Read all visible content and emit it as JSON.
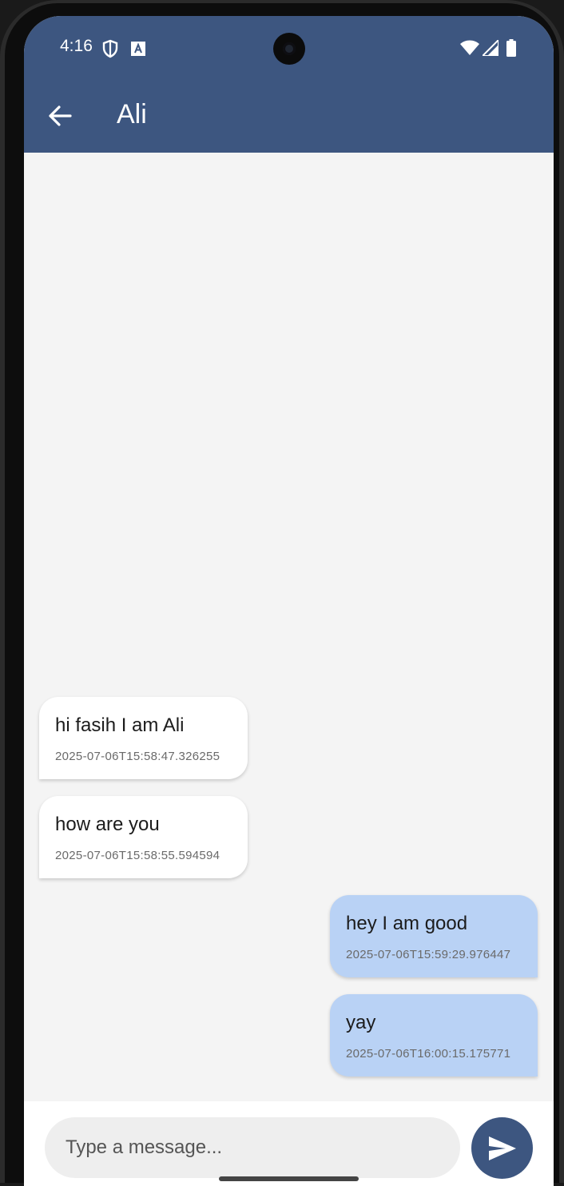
{
  "status_bar": {
    "time": "4:16",
    "icons": [
      "shield-icon",
      "a-icon",
      "wifi-icon",
      "signal-icon",
      "battery-icon"
    ]
  },
  "app_bar": {
    "title": "Ali",
    "back_icon": "arrow-back-icon",
    "background_color": "#3d5680"
  },
  "messages": [
    {
      "direction": "incoming",
      "text": "hi fasih I am Ali",
      "timestamp": "2025-07-06T15:58:47.326255"
    },
    {
      "direction": "incoming",
      "text": "how are you",
      "timestamp": "2025-07-06T15:58:55.594594"
    },
    {
      "direction": "outgoing",
      "text": "hey I am good",
      "timestamp": "2025-07-06T15:59:29.976447"
    },
    {
      "direction": "outgoing",
      "text": "yay",
      "timestamp": "2025-07-06T16:00:15.175771"
    }
  ],
  "input": {
    "placeholder": "Type a message...",
    "value": "",
    "send_icon": "send-icon"
  },
  "colors": {
    "primary": "#3d5680",
    "incoming_bubble": "#ffffff",
    "outgoing_bubble": "#b9d2f5",
    "background": "#f4f4f4"
  }
}
